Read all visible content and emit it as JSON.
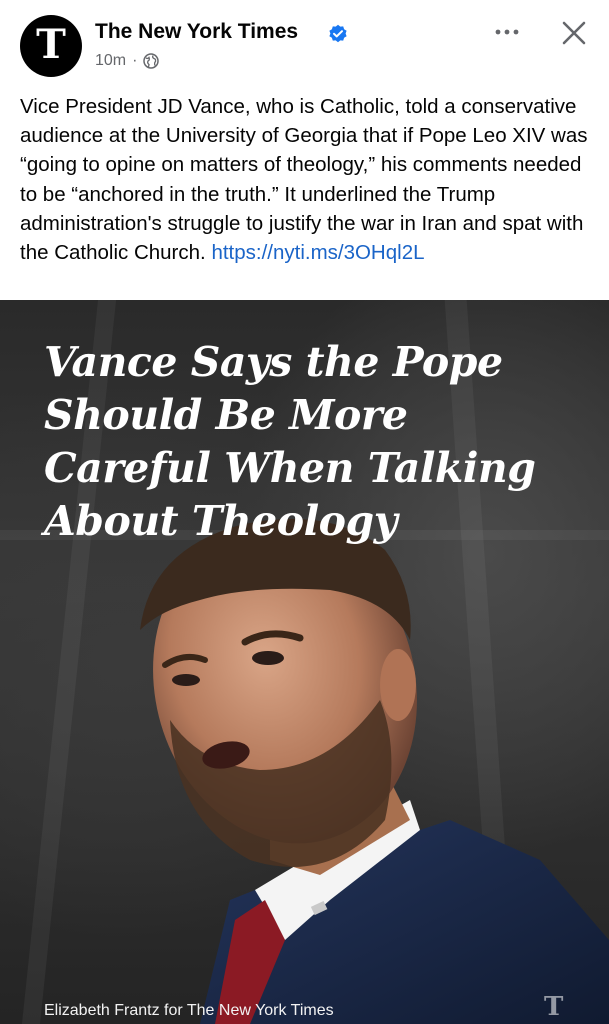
{
  "header": {
    "page_name": "The New York Times",
    "avatar_letter": "T",
    "timestamp": "10m",
    "separator": "·",
    "privacy_icon": "globe-icon",
    "verified_icon": "verified-badge-icon",
    "more_icon": "more-options-icon",
    "close_icon": "close-icon"
  },
  "post": {
    "text": "Vice President JD Vance, who is Catholic, told a conservative audience at the University of Georgia that if Pope Leo XIV was “going to opine on matters of theology,” his comments needed to be “anchored in the truth.” It underlined the Trump administration's struggle to justify the war in Iran and spat with the Catholic Church.",
    "link_text": "https://nyti.ms/3OHql2L"
  },
  "image": {
    "headline": "Vance Says the Pope Should Be More Careful When Talking About Theology",
    "credit": "Elizabeth Frantz for The New York Times",
    "watermark": "T"
  },
  "colors": {
    "link": "#1a64c8",
    "verified": "#1877f2",
    "secondary_text": "#65676b",
    "tie": "#8b1a24",
    "suit": "#1c2a4a"
  }
}
